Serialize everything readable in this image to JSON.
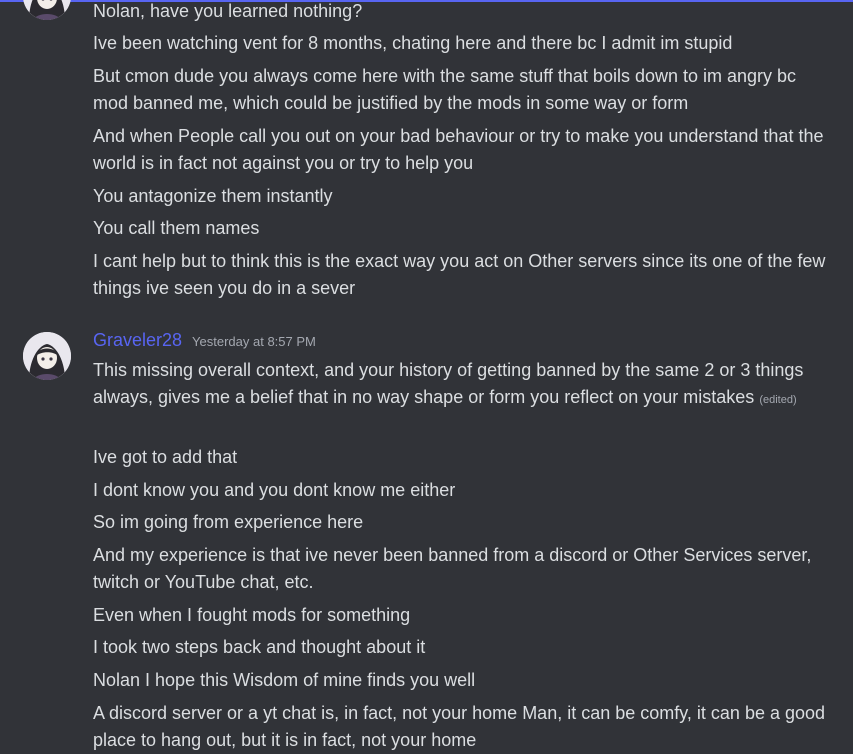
{
  "colors": {
    "background": "#313338",
    "text": "#dbdee1",
    "username": "#5865f2",
    "muted": "#a4a8b0",
    "top_border": "#5865f2"
  },
  "group1": {
    "messages": [
      "Nolan, have you learned nothing?",
      "Ive been watching vent for 8 months, chating here and there bc I admit im stupid",
      "But cmon dude you always come here with the same stuff that boils down to im angry bc mod banned me, which could be justified by the mods in some way or form",
      "And when People call you out on your bad behaviour or try to make you understand that the world is in fact not against you or try to help you",
      "You antagonize them instantly",
      "You call them names",
      "I cant help but to think this is the exact way you act on Other servers since its one of the few things ive seen you do in a sever"
    ]
  },
  "group2": {
    "username": "Graveler28",
    "timestamp": "Yesterday at 8:57 PM",
    "edited_label": "(edited)",
    "messages": [
      "This missing overall context, and your history of getting banned by the same 2 or 3 things always, gives me a belief that in no way shape or form you reflect on your mistakes",
      "Ive got to add that",
      "I dont know you and you dont know me either",
      "So im going from experience here",
      "And my experience is that ive never been banned from a discord or Other Services server, twitch or YouTube chat, etc.",
      "Even when I fought mods for something",
      "I took two steps back and thought about it",
      "Nolan I hope this Wisdom of mine finds you well",
      "A discord server or a yt chat is, in fact, not your home Man, it can be comfy, it can be a good place to hang out, but it is in fact, not your home"
    ]
  }
}
